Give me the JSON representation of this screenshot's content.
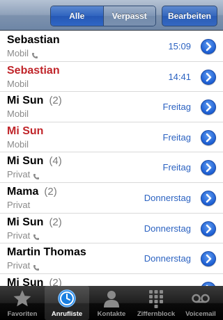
{
  "navbar": {
    "segments": [
      "Alle",
      "Verpasst"
    ],
    "active_segment": "Alle",
    "edit_label": "Bearbeiten"
  },
  "calls": [
    {
      "name": "Sebastian",
      "count": "",
      "type": "Mobil",
      "phone_icon": true,
      "time": "15:09",
      "missed": false
    },
    {
      "name": "Sebastian",
      "count": "",
      "type": "Mobil",
      "phone_icon": false,
      "time": "14:41",
      "missed": true
    },
    {
      "name": "Mi Sun",
      "count": "(2)",
      "type": "Mobil",
      "phone_icon": false,
      "time": "Freitag",
      "missed": false
    },
    {
      "name": "Mi Sun",
      "count": "",
      "type": "Mobil",
      "phone_icon": false,
      "time": "Freitag",
      "missed": true
    },
    {
      "name": "Mi Sun",
      "count": "(4)",
      "type": "Privat",
      "phone_icon": true,
      "time": "Freitag",
      "missed": false
    },
    {
      "name": "Mama",
      "count": "(2)",
      "type": "Privat",
      "phone_icon": false,
      "time": "Donnerstag",
      "missed": false
    },
    {
      "name": "Mi Sun",
      "count": "(2)",
      "type": "Privat",
      "phone_icon": true,
      "time": "Donnerstag",
      "missed": false
    },
    {
      "name": "Martin Thomas",
      "count": "",
      "type": "Privat",
      "phone_icon": true,
      "time": "Donnerstag",
      "missed": false
    },
    {
      "name": "Mi Sun",
      "count": "(2)",
      "type": "",
      "phone_icon": false,
      "time": "",
      "missed": false
    }
  ],
  "tabs": [
    {
      "label": "Favoriten",
      "icon": "star-icon",
      "active": false
    },
    {
      "label": "Anrufliste",
      "icon": "clock-icon",
      "active": true
    },
    {
      "label": "Kontakte",
      "icon": "contacts-icon",
      "active": false
    },
    {
      "label": "Ziffernblock",
      "icon": "keypad-icon",
      "active": false
    },
    {
      "label": "Voicemail",
      "icon": "voicemail-icon",
      "active": false
    }
  ],
  "colors": {
    "missed": "#c0252a",
    "accent": "#2b62c1"
  }
}
